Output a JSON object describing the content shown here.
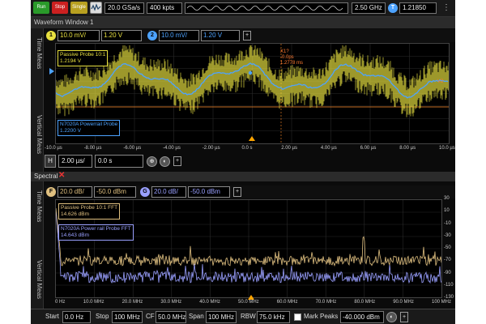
{
  "toolbar": {
    "run": "Run",
    "stop": "Stop",
    "single": "Single",
    "sample_rate": "20.0 GSa/s",
    "memory_depth": "400 kpts",
    "bandwidth": "2.50 GHz",
    "trigger_level": "1.21850"
  },
  "waveform_window": {
    "title": "Waveform Window 1",
    "tabs": [
      "Time Meas",
      "Vertical Meas"
    ],
    "channels": [
      {
        "id": "1",
        "scale": "10.0 mV/",
        "offset": "1.20 V",
        "color": "#e8e040"
      },
      {
        "id": "2",
        "scale": "10.0 mV/",
        "offset": "1.20 V",
        "color": "#4da3ff"
      }
    ],
    "labels": {
      "probe1_name": "Passive Probe 10:1",
      "probe1_value": "1.2194 V",
      "probe2_name": "N7020A Powerrail Probe",
      "probe2_value": "1.2200 V",
      "cursor1": "X1?",
      "cursor2": "-0.0ps",
      "cursor3": "1.2778 ms",
      "right_marker": "V2"
    },
    "x_ticks": [
      "-10.0 µs",
      "-8.00 µs",
      "-6.00 µs",
      "-4.00 µs",
      "-2.00 µs",
      "0.0 s",
      "2.00 µs",
      "4.00 µs",
      "6.00 µs",
      "8.00 µs",
      "10.0 µs"
    ],
    "timebase": "2.00 µs/",
    "position": "0.0 s"
  },
  "spectral_window": {
    "title": "Spectral",
    "tabs": [
      "Time Meas",
      "Vertical Meas"
    ],
    "channels": [
      {
        "id": "F",
        "scale": "20.0 dB/",
        "ref": "-50.0 dBm",
        "color": "#e0c080"
      },
      {
        "id": "G",
        "scale": "20.0 dB/",
        "ref": "-50.0 dBm",
        "color": "#9aa0ff"
      }
    ],
    "labels": {
      "fft1_name": "Passive Probe 10:1 FFT",
      "fft1_value": "14.626 dBm",
      "fft2_name": "N7020A Power rail Probe FFT",
      "fft2_value": "14.643 dBm"
    },
    "x_ticks": [
      "0 Hz",
      "10.0 MHz",
      "20.0 MHz",
      "30.0 MHz",
      "40.0 MHz",
      "50.0 MHz",
      "60.0 MHz",
      "70.0 MHz",
      "80.0 MHz",
      "90.0 MHz",
      "100 MHz"
    ],
    "y_ticks": [
      "30",
      "10",
      "-10",
      "-30",
      "-50",
      "-70",
      "-90",
      "-110",
      "-130"
    ]
  },
  "fft_controls": {
    "start_label": "Start",
    "start_value": "0.0 Hz",
    "stop_label": "Stop",
    "stop_value": "100 MHz",
    "cf_label": "CF",
    "cf_value": "50.0 MHz",
    "span_label": "Span",
    "span_value": "100 MHz",
    "rbw_label": "RBW",
    "rbw_value": "75.0 kHz",
    "mark_peaks_label": "Mark Peaks",
    "threshold_value": "-40.000 dBm"
  },
  "colors": {
    "ch1": "#e8e040",
    "ch2": "#4da3ff",
    "fft1": "#e0c080",
    "fft2": "#9aa0ff",
    "run": "#2a9a2a",
    "stop": "#cc2020",
    "single": "#b8a020"
  }
}
